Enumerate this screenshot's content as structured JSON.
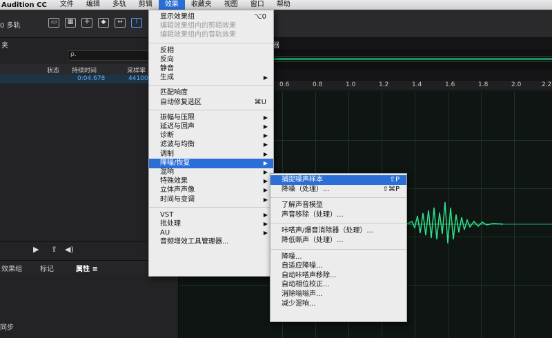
{
  "menubar": {
    "app": "Audition CC",
    "items": [
      "文件",
      "编辑",
      "多轨",
      "剪辑",
      "效果",
      "收藏夹",
      "视图",
      "窗口",
      "帮助"
    ]
  },
  "toolbar": {
    "label_left": "0 多轨"
  },
  "left_panel": {
    "title": "夹",
    "search_placeholder": "ρ.",
    "columns": [
      "状态",
      "持续时间",
      "采样率"
    ],
    "row": {
      "duration": "0:04.678",
      "rate": "44100 Hz"
    },
    "tabs": [
      "效果组",
      "标记",
      "属性 ≡"
    ],
    "footer_label": "同步"
  },
  "editor": {
    "title": "器",
    "ruler": [
      "0.6",
      "0.8",
      "1.0",
      "1.2",
      "1.4",
      "1.6",
      "1.8",
      "2.0",
      "2.2"
    ]
  },
  "effects_menu": {
    "items": [
      {
        "label": "显示效果组",
        "shortcut": "⌥0",
        "type": "normal"
      },
      {
        "label": "编辑效果组内的剪辑效果",
        "type": "disabled"
      },
      {
        "label": "编辑效果组内的音轨效果",
        "type": "disabled"
      },
      {
        "type": "sep"
      },
      {
        "label": "反相",
        "type": "normal"
      },
      {
        "label": "反向",
        "type": "normal"
      },
      {
        "label": "静音",
        "type": "normal"
      },
      {
        "label": "生成",
        "type": "submenu"
      },
      {
        "type": "sep"
      },
      {
        "label": "匹配响度",
        "type": "normal"
      },
      {
        "label": "自动修复选区",
        "shortcut": "⌘U",
        "type": "normal"
      },
      {
        "type": "sep"
      },
      {
        "label": "振幅与压限",
        "type": "submenu"
      },
      {
        "label": "延迟与回声",
        "type": "submenu"
      },
      {
        "label": "诊断",
        "type": "submenu"
      },
      {
        "label": "滤波与均衡",
        "type": "submenu"
      },
      {
        "label": "调制",
        "type": "submenu"
      },
      {
        "label": "降噪/恢复",
        "type": "submenu-hl"
      },
      {
        "label": "混响",
        "type": "submenu"
      },
      {
        "label": "特殊效果",
        "type": "submenu"
      },
      {
        "label": "立体声声像",
        "type": "submenu"
      },
      {
        "label": "时间与变调",
        "type": "submenu"
      },
      {
        "type": "sep"
      },
      {
        "label": "VST",
        "type": "submenu"
      },
      {
        "label": "批处理",
        "type": "submenu"
      },
      {
        "label": "AU",
        "type": "submenu"
      },
      {
        "label": "音频增效工具管理器...",
        "type": "normal"
      }
    ]
  },
  "noise_submenu": {
    "items": [
      {
        "label": "捕捉噪声样本",
        "shortcut": "⇧P",
        "type": "hl"
      },
      {
        "label": "降噪（处理）...",
        "shortcut": "⇧⌘P",
        "type": "normal"
      },
      {
        "type": "sep"
      },
      {
        "label": "了解声音模型",
        "type": "normal"
      },
      {
        "label": "声音移除（处理）...",
        "type": "normal"
      },
      {
        "type": "sep"
      },
      {
        "label": "咔嗒声/爆音消除器（处理）...",
        "type": "normal"
      },
      {
        "label": "降低嘶声（处理）...",
        "type": "normal"
      },
      {
        "type": "sep"
      },
      {
        "label": "降噪...",
        "type": "normal"
      },
      {
        "label": "自适应降噪...",
        "type": "normal"
      },
      {
        "label": "自动咔嗒声移除...",
        "type": "normal"
      },
      {
        "label": "自动相位校正...",
        "type": "normal"
      },
      {
        "label": "消除嗡嗡声...",
        "type": "normal"
      },
      {
        "label": "减少混响...",
        "type": "normal"
      }
    ]
  },
  "colors": {
    "accent": "#2b6fd6",
    "waveform": "#2fe08a"
  }
}
